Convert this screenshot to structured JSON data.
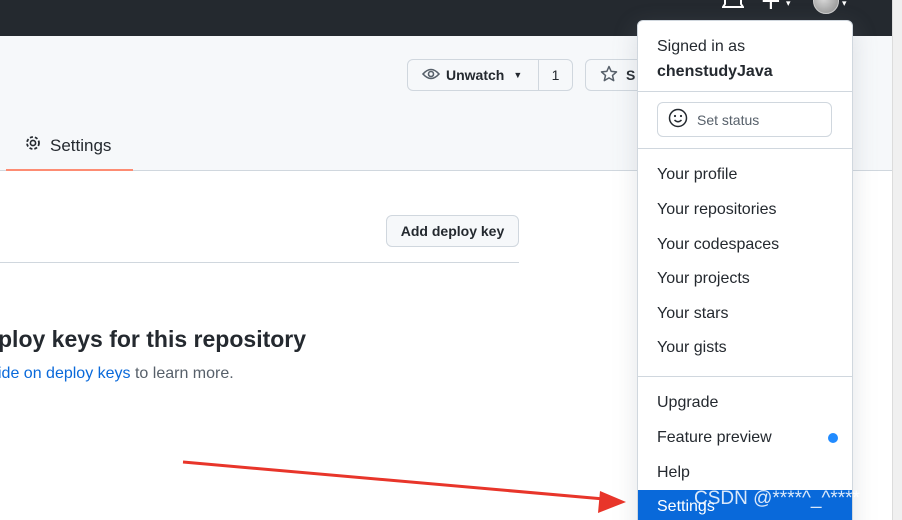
{
  "repo": {
    "watch_label": "Unwatch",
    "watch_count": "1",
    "star_label": "S",
    "tab_settings": "Settings",
    "add_deploy_key": "Add deploy key",
    "blank_title": "ploy keys for this repository",
    "blank_link": "ide on deploy keys",
    "blank_suffix": " to learn more."
  },
  "menu": {
    "signed_in_as": "Signed in as",
    "username": "chenstudyJava",
    "set_status": "Set status",
    "items": [
      "Your profile",
      "Your repositories",
      "Your codespaces",
      "Your projects",
      "Your stars",
      "Your gists"
    ],
    "upgrade": "Upgrade",
    "feature_preview": "Feature preview",
    "help": "Help",
    "settings": "Settings"
  },
  "watermark": "CSDN @****^_^****",
  "colors": {
    "header_bg": "#24292f",
    "accent_blue": "#0969da",
    "arrow_red": "#e8352a"
  }
}
